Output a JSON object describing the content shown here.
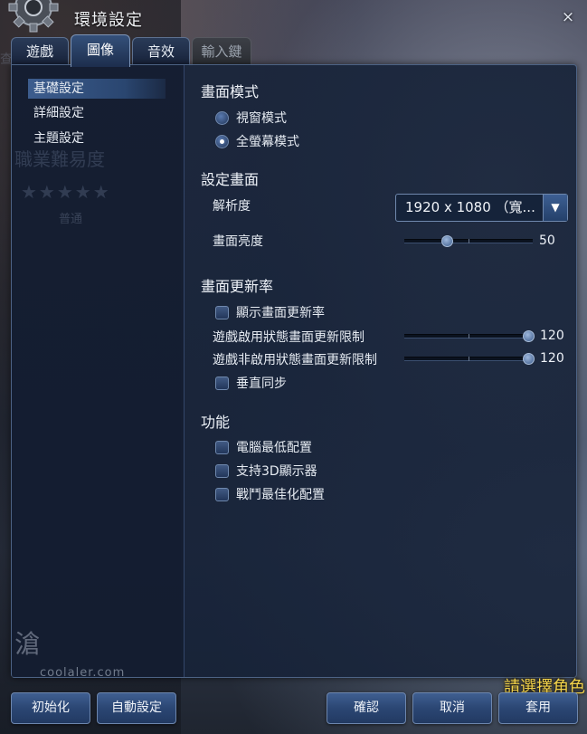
{
  "window": {
    "title": "環境設定",
    "close_glyph": "×"
  },
  "tabs": [
    {
      "label": "遊戲",
      "state": "normal"
    },
    {
      "label": "圖像",
      "state": "active"
    },
    {
      "label": "音效",
      "state": "normal"
    },
    {
      "label": "輸入鍵",
      "state": "disabled"
    }
  ],
  "sidebar": {
    "items": [
      {
        "label": "基礎設定",
        "active": true
      },
      {
        "label": "詳細設定",
        "active": false
      },
      {
        "label": "主題設定",
        "active": false
      }
    ]
  },
  "background_text": {
    "left_fragment": "查",
    "title": "職業難易度",
    "stars": "★★★★★",
    "subtitle": "普通"
  },
  "screen_mode": {
    "heading": "畫面模式",
    "options": [
      {
        "label": "視窗模式",
        "selected": false
      },
      {
        "label": "全螢幕模式",
        "selected": true
      }
    ]
  },
  "display": {
    "heading": "設定畫面",
    "resolution_label": "解析度",
    "resolution_value": "1920  x  1080  （寬...",
    "brightness_label": "畫面亮度",
    "brightness_value": "50",
    "brightness_fraction": 0.33
  },
  "refresh": {
    "heading": "畫面更新率",
    "show_rate_label": "顯示畫面更新率",
    "active_limit_label": "遊戲啟用狀態畫面更新限制",
    "active_limit_value": "120",
    "inactive_limit_label": "遊戲非啟用狀態畫面更新限制",
    "inactive_limit_value": "120",
    "vsync_label": "垂直同步"
  },
  "features": {
    "heading": "功能",
    "options": [
      {
        "label": "電腦最低配置",
        "checked": false
      },
      {
        "label": "支持3D顯示器",
        "checked": false
      },
      {
        "label": "戰鬥最佳化配置",
        "checked": false
      }
    ]
  },
  "buttons": {
    "reset": "初始化",
    "auto": "自動設定",
    "confirm": "確認",
    "cancel": "取消",
    "apply": "套用"
  },
  "overlay": {
    "watermark": "coolaler.com",
    "character_prompt": "請選擇角色"
  },
  "colors": {
    "panel": "#18243a",
    "accent": "#2b4673",
    "highlight_text": "#f2d24a"
  }
}
